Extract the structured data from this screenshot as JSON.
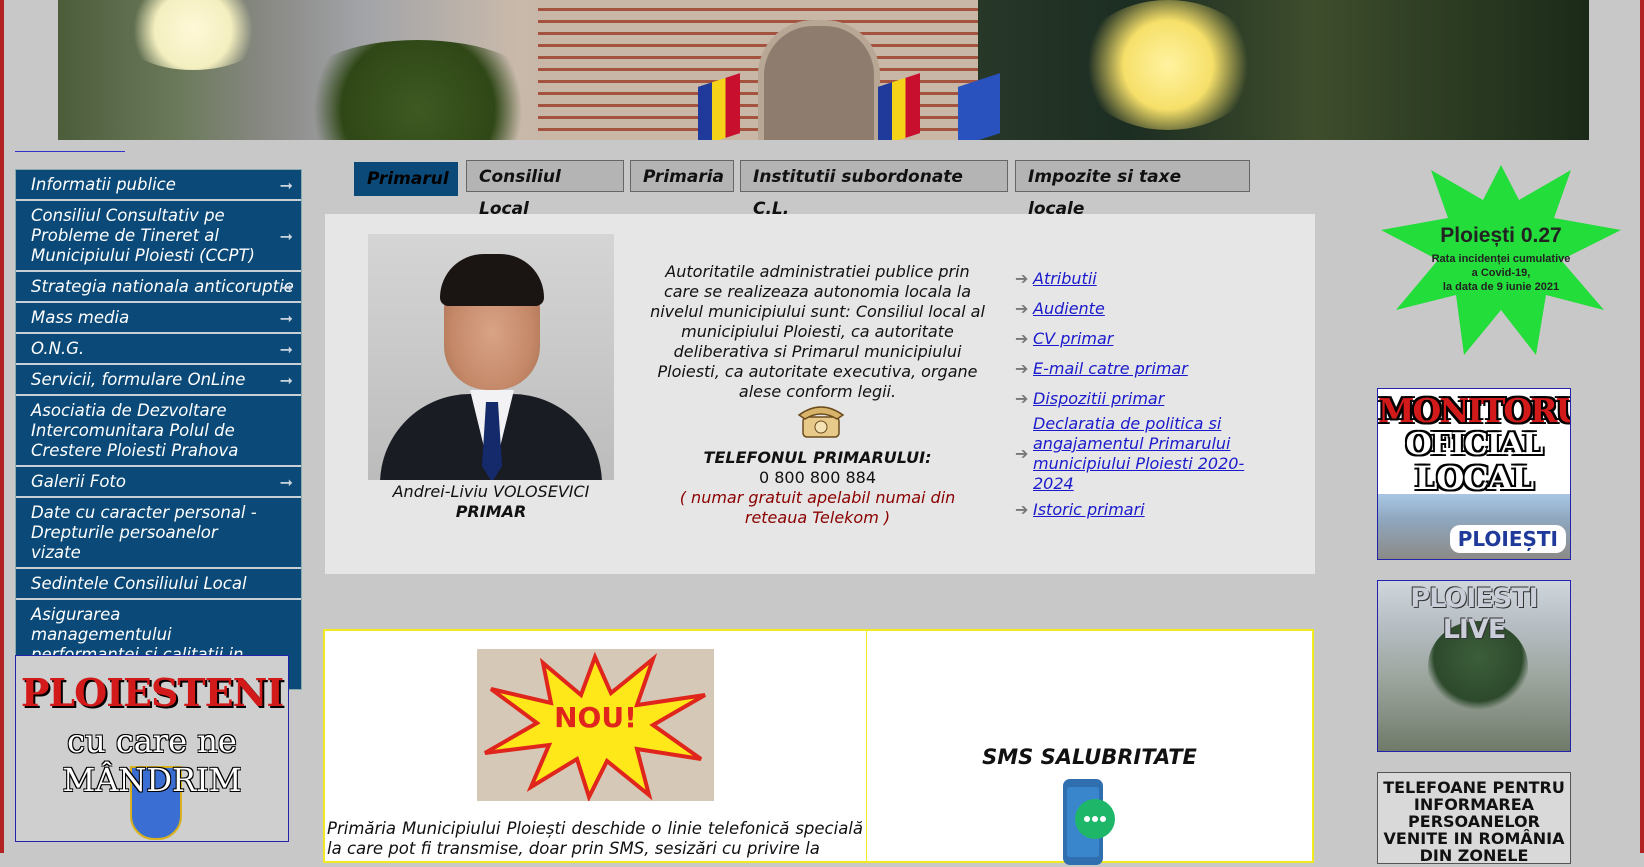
{
  "banner": {
    "icon": "city-banner-photo"
  },
  "left_menu": {
    "items": [
      {
        "label": "Informatii publice",
        "has_arrow": true
      },
      {
        "label": "Consiliul Consultativ pe Probleme de Tineret al Municipiului Ploiesti (CCPT)",
        "has_arrow": true
      },
      {
        "label": "Strategia nationala anticoruptie",
        "has_arrow": true
      },
      {
        "label": "Mass media",
        "has_arrow": true
      },
      {
        "label": "O.N.G.",
        "has_arrow": true
      },
      {
        "label": "Servicii, formulare OnLine",
        "has_arrow": true
      },
      {
        "label": "Asociatia de Dezvoltare Intercomunitara Polul de Crestere Ploiesti Prahova",
        "has_arrow": false
      },
      {
        "label": "Galerii Foto",
        "has_arrow": true
      },
      {
        "label": "Date cu caracter personal - Drepturile persoanelor vizate",
        "has_arrow": false
      },
      {
        "label": "Sedintele Consiliului Local",
        "has_arrow": false
      },
      {
        "label": "Asigurarea managementului performantei si calitatii in municipiul Ploiesti",
        "has_arrow": false
      }
    ],
    "arrow_glyph": "➞"
  },
  "ploiesteni_banner": {
    "line1": "PLOIESTENI",
    "line2": "cu care ne",
    "line3": "MÂNDRIM"
  },
  "tabs": [
    {
      "label": "Primarul",
      "active": true
    },
    {
      "label": "Consiliul Local",
      "active": false
    },
    {
      "label": "Primaria",
      "active": false
    },
    {
      "label": "Institutii subordonate C.L.",
      "active": false
    },
    {
      "label": "Impozite si taxe locale",
      "active": false
    }
  ],
  "mayor": {
    "name": "Andrei-Liviu VOLOSEVICI",
    "title": "PRIMAR",
    "description": "Autoritatile administratiei publice prin care se realizeaza autonomia locala la nivelul municipiului sunt: Consiliul local al municipiului Ploiesti, ca autoritate deliberativa si Primarul municipiului Ploiesti, ca autoritate executiva, organe alese conform legii.",
    "phone_label": "TELEFONUL PRIMARULUI:",
    "phone_number": "0 800 800 884",
    "phone_note": "( numar gratuit apelabil numai din reteaua Telekom )"
  },
  "mayor_links": [
    "Atributii",
    "Audiente",
    "CV primar",
    "E-mail catre primar",
    "Dispozitii primar",
    "Declaratia de politica si angajamentul Primarului municipiului Ploiesti 2020-2024",
    "Istoric primari"
  ],
  "news_box": {
    "badge": "NOU!",
    "text": "Primăria Municipiului Ploiești deschide o linie telefonică specială la care pot fi transmise, doar prin SMS, sesizări cu privire la"
  },
  "sms_box": {
    "title": "SMS SALUBRITATE"
  },
  "covid_star": {
    "title": "Ploiești 0.27",
    "line1": "Rata incidenței cumulative",
    "line2": "a Covid-19,",
    "line3": "la data de 9 iunie 2021",
    "color": "#22dd3a"
  },
  "monitorul": {
    "line1": "MONITORUL",
    "line2": "OFICIAL",
    "line3": "LOCAL",
    "badge": "PLOIEȘTI"
  },
  "ploiesti_live": {
    "title": "PLOIESTI LIVE"
  },
  "tel_box": {
    "text": "TELEFOANE PENTRU INFORMAREA PERSOANELOR VENITE IN ROMÂNIA DIN ZONELE"
  },
  "colors": {
    "menu_bg": "#0b4a78",
    "link": "#1a1acc",
    "note_red": "#8b0000",
    "box_border": "#f0ea1e",
    "frame": "#b22222"
  }
}
